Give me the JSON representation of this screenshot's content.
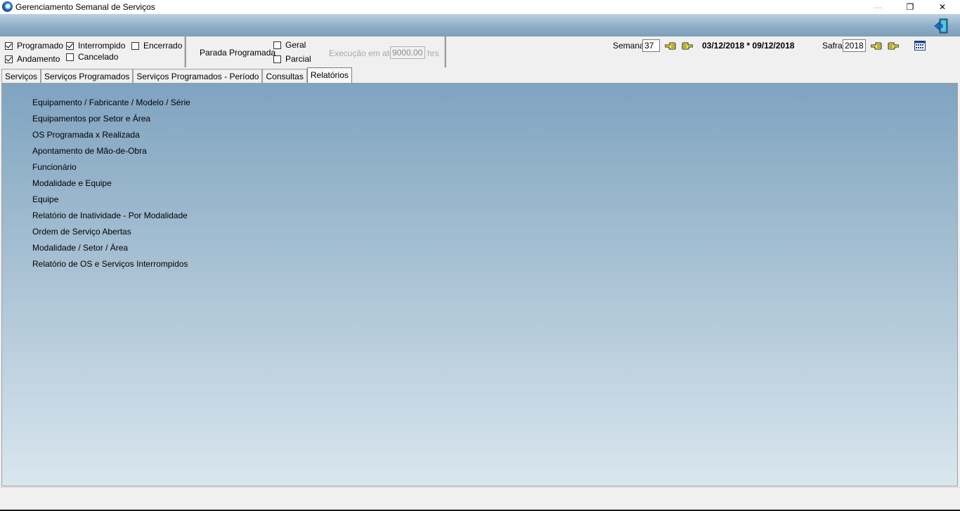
{
  "window": {
    "title": "Gerenciamento Semanal de Serviços",
    "minimize_glyph": "—",
    "maximize_glyph": "❐",
    "close_glyph": "✕"
  },
  "header": {
    "exit_icon": "exit-door-icon"
  },
  "filters": {
    "status": [
      {
        "label": "Programado",
        "checked": true
      },
      {
        "label": "Andamento",
        "checked": true
      },
      {
        "label": "Interrompido",
        "checked": true
      },
      {
        "label": "Cancelado",
        "checked": false
      },
      {
        "label": "Encerrado",
        "checked": false
      }
    ],
    "parada_label": "Parada Programada",
    "parada": [
      {
        "label": "Geral",
        "checked": false
      },
      {
        "label": "Parcial",
        "checked": false
      }
    ],
    "execucao_label": "Execução em até",
    "execucao_value": "9000.00",
    "execucao_unit": "hrs"
  },
  "week": {
    "label": "Semana",
    "value": "37",
    "range": "03/12/2018 * 09/12/2018",
    "prev_icon": "hand-left-icon",
    "next_icon": "hand-right-icon"
  },
  "safra": {
    "label": "Safra",
    "value": "2018",
    "prev_icon": "hand-left-icon",
    "next_icon": "hand-right-icon",
    "calendar_icon": "calendar-icon"
  },
  "tabs": [
    {
      "label": "Serviços",
      "active": false
    },
    {
      "label": "Serviços Programados",
      "active": false
    },
    {
      "label": "Serviços Programados - Período",
      "active": false
    },
    {
      "label": "Consultas",
      "active": false
    },
    {
      "label": "Relatórios",
      "active": true
    }
  ],
  "reports": [
    "Equipamento / Fabricante / Modelo / Série",
    "Equipamentos por Setor e Área",
    "OS Programada x Realizada",
    "Apontamento de Mão-de-Obra",
    "Funcionário",
    "Modalidade e Equipe",
    "Equipe",
    "Relatório de Inatividade - Por  Modalidade",
    "Ordem de Serviço Abertas",
    "Modalidade / Setor / Área",
    "Relatório de OS e Serviços Interrompidos"
  ],
  "colors": {
    "content_top": "#7fa4c0",
    "content_bottom": "#d9e6ee",
    "header_band": "#8eafc8"
  }
}
